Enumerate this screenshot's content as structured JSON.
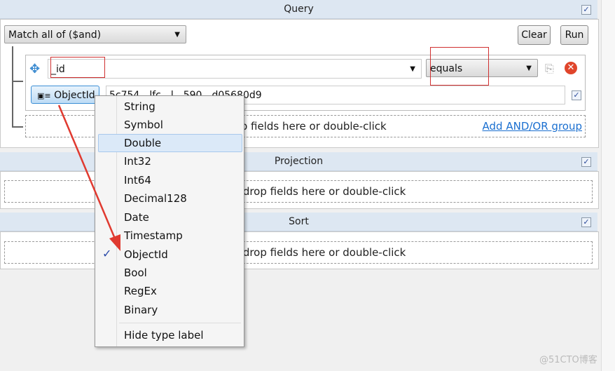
{
  "query": {
    "title": "Query",
    "match": "Match all of ($and)",
    "clear": "Clear",
    "run": "Run",
    "field": "_id",
    "operator": "equals",
    "type_button": "ObjectId",
    "value": "5c754…lfc…l…590…d05680d9",
    "drop_hint": "Drag and drop fields here or double-click",
    "add_group": "Add AND/OR group"
  },
  "projection": {
    "title": "Projection",
    "drop_hint": "Drag and drop fields here or double-click"
  },
  "sort": {
    "title": "Sort",
    "drop_hint": "Drag and drop fields here or double-click"
  },
  "menu": {
    "items": [
      "String",
      "Symbol",
      "Double",
      "Int32",
      "Int64",
      "Decimal128",
      "Date",
      "Timestamp",
      "ObjectId",
      "Bool",
      "RegEx",
      "Binary"
    ],
    "checked": "ObjectId",
    "hovered": "Double",
    "hide_label": "Hide type label"
  },
  "watermark": "@51CTO博客"
}
